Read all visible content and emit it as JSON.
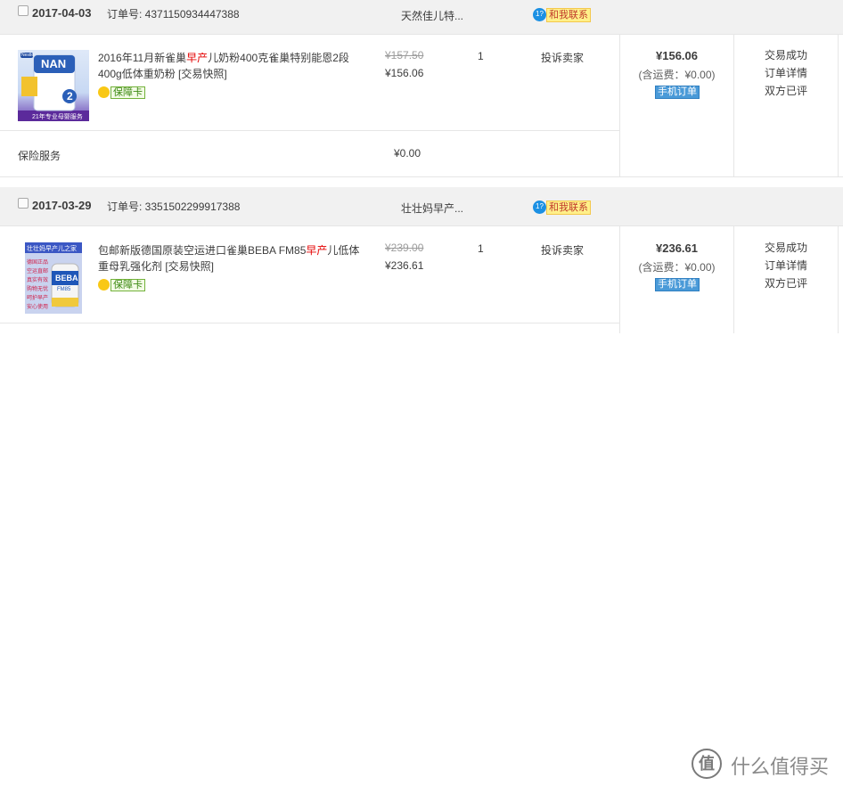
{
  "orders": [
    {
      "date": "2017-04-03",
      "order_no": "订单号: 4371150934447388",
      "shop": "天然佳儿特...",
      "contact": "和我联系",
      "title_parts": [
        "2016年11月新雀巢",
        "早产",
        "儿奶粉400克雀巢特别能恩2段400g低体重奶粉 [交易快照]"
      ],
      "badge": "保障卡",
      "price_old": "¥157.50",
      "price_new": "¥156.06",
      "qty": "1",
      "complain": "投诉卖家",
      "total": "¥156.06",
      "shipping": "(含运费：¥0.00)",
      "mobile": "手机订单",
      "status": [
        "交易成功",
        "订单详情",
        "双方已评"
      ],
      "service_label": "保险服务",
      "service_price": "¥0.00",
      "thumb": {
        "brand": "NAN",
        "stage": "2",
        "footer": "21年专业母婴服务",
        "logo": "Nestlé"
      }
    },
    {
      "date": "2017-03-29",
      "order_no": "订单号: 3351502299917388",
      "shop": "壮壮妈早产...",
      "contact": "和我联系",
      "title_parts": [
        "包邮新版德国原装空运进口雀巢BEBA FM85",
        "早产",
        "儿低体重母乳强化剂 [交易快照]"
      ],
      "badge": "保障卡",
      "price_old": "¥239.00",
      "price_new": "¥236.61",
      "qty": "1",
      "complain": "投诉卖家",
      "total": "¥236.61",
      "shipping": "(含运费：¥0.00)",
      "mobile": "手机订单",
      "status": [
        "交易成功",
        "订单详情",
        "双方已评"
      ],
      "thumb": {
        "header": "壮壮妈早产儿之家",
        "brand": "BEBA",
        "sub": "FM85",
        "lines": [
          "德国正品",
          "空运直邮",
          "真实有效",
          "购物无忧",
          "呵护早产",
          "安心使用"
        ]
      }
    }
  ],
  "watermark": {
    "symbol": "值",
    "text": "什么值得买"
  },
  "colors": {
    "accent_red": "#e40000",
    "header_bg": "#f1f1f1",
    "mobile_badge": "#4a9ad8",
    "wangwang": "#1b90e3"
  }
}
